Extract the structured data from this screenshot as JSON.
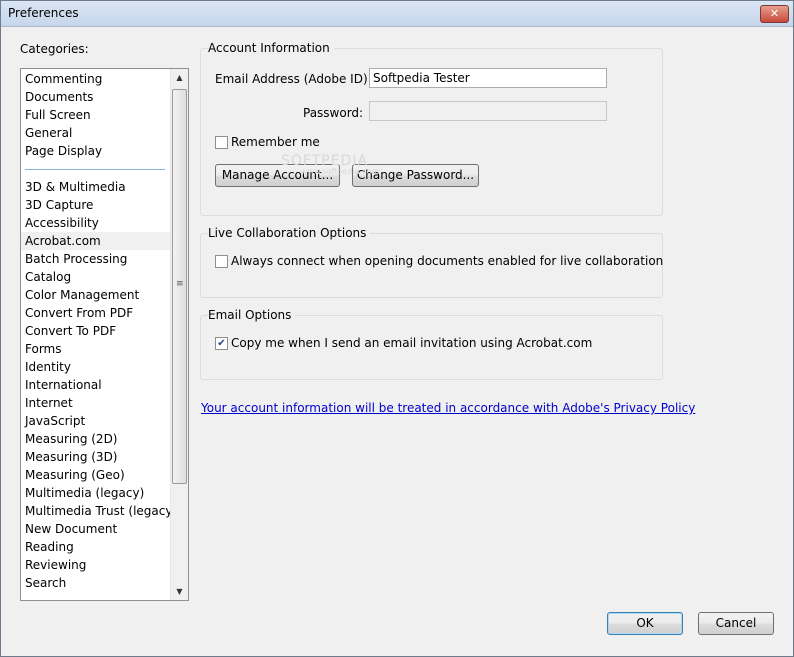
{
  "window": {
    "title": "Preferences",
    "close_glyph": "✕"
  },
  "categories": {
    "label": "Categories:",
    "group1": [
      "Commenting",
      "Documents",
      "Full Screen",
      "General",
      "Page Display"
    ],
    "group2": [
      "3D & Multimedia",
      "3D Capture",
      "Accessibility",
      "Acrobat.com",
      "Batch Processing",
      "Catalog",
      "Color Management",
      "Convert From PDF",
      "Convert To PDF",
      "Forms",
      "Identity",
      "International",
      "Internet",
      "JavaScript",
      "Measuring (2D)",
      "Measuring (3D)",
      "Measuring (Geo)",
      "Multimedia (legacy)",
      "Multimedia Trust (legacy)",
      "New Document",
      "Reading",
      "Reviewing",
      "Search"
    ],
    "selected": "Acrobat.com",
    "scroll_up_glyph": "▲",
    "scroll_down_glyph": "▼",
    "grip_glyph": "≡"
  },
  "account": {
    "group_label": "Account Information",
    "email_label": "Email Address (Adobe ID):",
    "email_value": "Softpedia Tester",
    "password_label": "Password:",
    "password_value": "",
    "remember_label": "Remember me",
    "remember_checked": false,
    "manage_button": "Manage Account...",
    "change_password_button": "Change Password..."
  },
  "live_collab": {
    "group_label": "Live Collaboration Options",
    "always_connect_label": "Always connect when opening documents enabled for live collaboration",
    "always_connect_checked": false
  },
  "email_options": {
    "group_label": "Email Options",
    "copy_me_label": "Copy me when I send an email invitation using Acrobat.com",
    "copy_me_checked": true,
    "check_glyph": "✔"
  },
  "privacy_link": "Your account information will be treated in accordance with Adobe's Privacy Policy",
  "watermark": {
    "main": "SOFTPEDIA",
    "sub": "www.softpedia.com"
  },
  "footer": {
    "ok": "OK",
    "cancel": "Cancel"
  }
}
